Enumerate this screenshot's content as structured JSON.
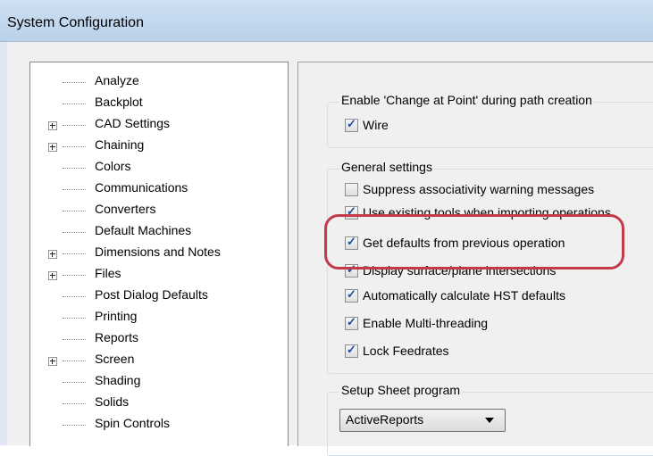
{
  "window": {
    "title": "System Configuration"
  },
  "tree": {
    "items": [
      {
        "label": "Analyze",
        "expandable": false
      },
      {
        "label": "Backplot",
        "expandable": false
      },
      {
        "label": "CAD Settings",
        "expandable": true
      },
      {
        "label": "Chaining",
        "expandable": true
      },
      {
        "label": "Colors",
        "expandable": false
      },
      {
        "label": "Communications",
        "expandable": false
      },
      {
        "label": "Converters",
        "expandable": false
      },
      {
        "label": "Default Machines",
        "expandable": false
      },
      {
        "label": "Dimensions and Notes",
        "expandable": true
      },
      {
        "label": "Files",
        "expandable": true
      },
      {
        "label": "Post Dialog Defaults",
        "expandable": false
      },
      {
        "label": "Printing",
        "expandable": false
      },
      {
        "label": "Reports",
        "expandable": false
      },
      {
        "label": "Screen",
        "expandable": true
      },
      {
        "label": "Shading",
        "expandable": false
      },
      {
        "label": "Solids",
        "expandable": false
      },
      {
        "label": "Spin Controls",
        "expandable": false
      }
    ]
  },
  "change_at_point": {
    "legend": "Enable 'Change at Point' during path creation",
    "options": [
      {
        "label": "Wire",
        "checked": true
      }
    ]
  },
  "general": {
    "legend": "General settings",
    "options": [
      {
        "label": "Suppress associativity warning messages",
        "checked": false
      },
      {
        "label": "Use existing tools when importing operations",
        "checked": true
      },
      {
        "label": "Get defaults from previous operation",
        "checked": true
      },
      {
        "label": "Display surface/plane intersections",
        "checked": true
      },
      {
        "label": "Automatically calculate HST defaults",
        "checked": true
      },
      {
        "label": "Enable Multi-threading",
        "checked": true
      },
      {
        "label": "Lock Feedrates",
        "checked": true
      }
    ]
  },
  "setup_sheet": {
    "legend": "Setup Sheet program",
    "selected": "ActiveReports"
  }
}
